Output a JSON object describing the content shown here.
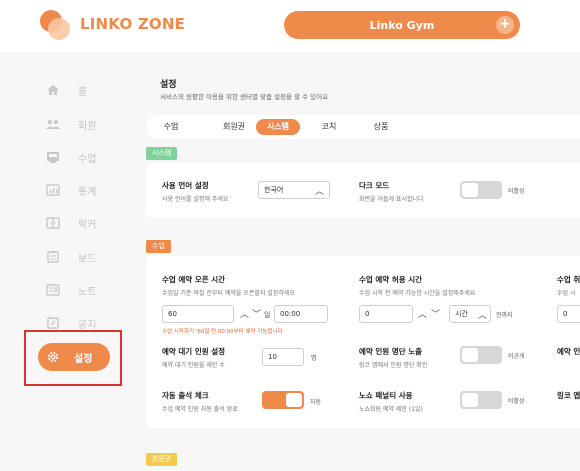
{
  "brand": {
    "name": "LINKO ZONE"
  },
  "gym": {
    "name": "Linko Gym",
    "add": "+"
  },
  "sidebar": {
    "items": [
      {
        "label": "홈",
        "icon": "home-icon"
      },
      {
        "label": "회원",
        "icon": "members-icon"
      },
      {
        "label": "수업",
        "icon": "class-icon"
      },
      {
        "label": "통계",
        "icon": "stats-icon"
      },
      {
        "label": "락커",
        "icon": "locker-icon"
      },
      {
        "label": "보드",
        "icon": "board-icon"
      },
      {
        "label": "노트",
        "icon": "note-icon"
      },
      {
        "label": "공지",
        "icon": "notice-icon"
      }
    ],
    "active": {
      "label": "설정",
      "icon": "gear-icon"
    }
  },
  "page": {
    "title": "설정",
    "desc": "서비스의 원활한 이용을 위한 센터별 맞춤 설정을 할 수 있어요"
  },
  "tabs": [
    {
      "label": "수업"
    },
    {
      "label": "회원권"
    },
    {
      "label": "시스템",
      "active": true
    },
    {
      "label": "코치"
    },
    {
      "label": "상품"
    }
  ],
  "system": {
    "tag": "시스템",
    "language": {
      "label": "사용 언어 설정",
      "desc": "사용 언어를 설정해 주세요",
      "value": "한국어"
    },
    "dark": {
      "label": "다크 모드",
      "desc": "화면을 어둡게 표시합니다",
      "state": "비활성"
    }
  },
  "class": {
    "tag": "수업",
    "open": {
      "label": "수업 예약 오픈 시간",
      "desc": "수업일 기준 며칠 전부터 예약을 오픈할지 설정하세요",
      "days": "60",
      "day_unit": "일",
      "time": "00:00",
      "hint": "수업 시작하기 '60일'전 00:00부터 예약 가능합니다"
    },
    "allow": {
      "label": "수업 예약 허용 시간",
      "desc": "수업 시작 전 예약 가능한 시간을 설정해주세요",
      "value": "0",
      "unit": "시간",
      "suffix": "전까지"
    },
    "cut1": {
      "label": "수업 취",
      "desc": "수업 시",
      "value": "0"
    },
    "waitlist": {
      "label": "예약 대기 인원 설정",
      "desc": "예약 대기 인원을 제한 수",
      "value": "10",
      "unit": "명"
    },
    "expose": {
      "label": "예약 인원 명단 노출",
      "desc": "링코 앱에서 인원 명단 확인",
      "state": "비공개"
    },
    "cut2": {
      "label": "예약 인"
    },
    "attend": {
      "label": "자동 출석 체크",
      "desc": "수업 예약 인원 자동 출석 완료",
      "state": "자동"
    },
    "penalty": {
      "label": "노쇼 패널티 사용",
      "desc": "노쇼회원 예약 제한 (1일)",
      "state": "비활성"
    },
    "cut3": {
      "label": "링코 앱"
    }
  },
  "membership": {
    "tag": "회원권"
  },
  "colors": {
    "accent": "#f08a4b",
    "system_tag": "#7fd39a",
    "membership_tag": "#f5c94f",
    "highlight_box": "#d9362b"
  }
}
